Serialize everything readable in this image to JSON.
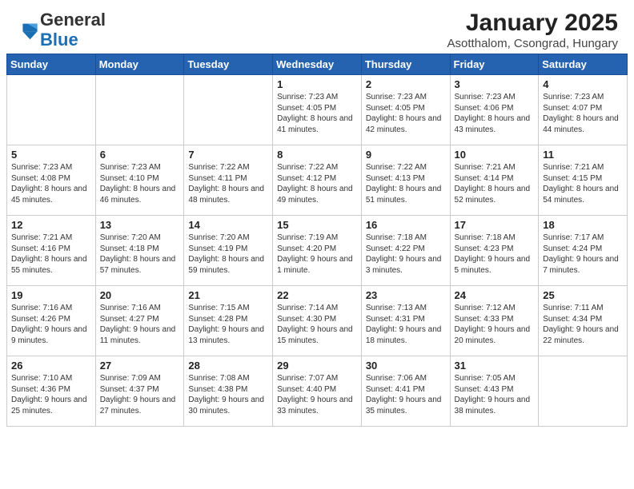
{
  "header": {
    "logo_general": "General",
    "logo_blue": "Blue",
    "month": "January 2025",
    "location": "Asotthalom, Csongrad, Hungary"
  },
  "days_of_week": [
    "Sunday",
    "Monday",
    "Tuesday",
    "Wednesday",
    "Thursday",
    "Friday",
    "Saturday"
  ],
  "weeks": [
    [
      {
        "day": "",
        "info": ""
      },
      {
        "day": "",
        "info": ""
      },
      {
        "day": "",
        "info": ""
      },
      {
        "day": "1",
        "info": "Sunrise: 7:23 AM\nSunset: 4:05 PM\nDaylight: 8 hours and 41 minutes."
      },
      {
        "day": "2",
        "info": "Sunrise: 7:23 AM\nSunset: 4:05 PM\nDaylight: 8 hours and 42 minutes."
      },
      {
        "day": "3",
        "info": "Sunrise: 7:23 AM\nSunset: 4:06 PM\nDaylight: 8 hours and 43 minutes."
      },
      {
        "day": "4",
        "info": "Sunrise: 7:23 AM\nSunset: 4:07 PM\nDaylight: 8 hours and 44 minutes."
      }
    ],
    [
      {
        "day": "5",
        "info": "Sunrise: 7:23 AM\nSunset: 4:08 PM\nDaylight: 8 hours and 45 minutes."
      },
      {
        "day": "6",
        "info": "Sunrise: 7:23 AM\nSunset: 4:10 PM\nDaylight: 8 hours and 46 minutes."
      },
      {
        "day": "7",
        "info": "Sunrise: 7:22 AM\nSunset: 4:11 PM\nDaylight: 8 hours and 48 minutes."
      },
      {
        "day": "8",
        "info": "Sunrise: 7:22 AM\nSunset: 4:12 PM\nDaylight: 8 hours and 49 minutes."
      },
      {
        "day": "9",
        "info": "Sunrise: 7:22 AM\nSunset: 4:13 PM\nDaylight: 8 hours and 51 minutes."
      },
      {
        "day": "10",
        "info": "Sunrise: 7:21 AM\nSunset: 4:14 PM\nDaylight: 8 hours and 52 minutes."
      },
      {
        "day": "11",
        "info": "Sunrise: 7:21 AM\nSunset: 4:15 PM\nDaylight: 8 hours and 54 minutes."
      }
    ],
    [
      {
        "day": "12",
        "info": "Sunrise: 7:21 AM\nSunset: 4:16 PM\nDaylight: 8 hours and 55 minutes."
      },
      {
        "day": "13",
        "info": "Sunrise: 7:20 AM\nSunset: 4:18 PM\nDaylight: 8 hours and 57 minutes."
      },
      {
        "day": "14",
        "info": "Sunrise: 7:20 AM\nSunset: 4:19 PM\nDaylight: 8 hours and 59 minutes."
      },
      {
        "day": "15",
        "info": "Sunrise: 7:19 AM\nSunset: 4:20 PM\nDaylight: 9 hours and 1 minute."
      },
      {
        "day": "16",
        "info": "Sunrise: 7:18 AM\nSunset: 4:22 PM\nDaylight: 9 hours and 3 minutes."
      },
      {
        "day": "17",
        "info": "Sunrise: 7:18 AM\nSunset: 4:23 PM\nDaylight: 9 hours and 5 minutes."
      },
      {
        "day": "18",
        "info": "Sunrise: 7:17 AM\nSunset: 4:24 PM\nDaylight: 9 hours and 7 minutes."
      }
    ],
    [
      {
        "day": "19",
        "info": "Sunrise: 7:16 AM\nSunset: 4:26 PM\nDaylight: 9 hours and 9 minutes."
      },
      {
        "day": "20",
        "info": "Sunrise: 7:16 AM\nSunset: 4:27 PM\nDaylight: 9 hours and 11 minutes."
      },
      {
        "day": "21",
        "info": "Sunrise: 7:15 AM\nSunset: 4:28 PM\nDaylight: 9 hours and 13 minutes."
      },
      {
        "day": "22",
        "info": "Sunrise: 7:14 AM\nSunset: 4:30 PM\nDaylight: 9 hours and 15 minutes."
      },
      {
        "day": "23",
        "info": "Sunrise: 7:13 AM\nSunset: 4:31 PM\nDaylight: 9 hours and 18 minutes."
      },
      {
        "day": "24",
        "info": "Sunrise: 7:12 AM\nSunset: 4:33 PM\nDaylight: 9 hours and 20 minutes."
      },
      {
        "day": "25",
        "info": "Sunrise: 7:11 AM\nSunset: 4:34 PM\nDaylight: 9 hours and 22 minutes."
      }
    ],
    [
      {
        "day": "26",
        "info": "Sunrise: 7:10 AM\nSunset: 4:36 PM\nDaylight: 9 hours and 25 minutes."
      },
      {
        "day": "27",
        "info": "Sunrise: 7:09 AM\nSunset: 4:37 PM\nDaylight: 9 hours and 27 minutes."
      },
      {
        "day": "28",
        "info": "Sunrise: 7:08 AM\nSunset: 4:38 PM\nDaylight: 9 hours and 30 minutes."
      },
      {
        "day": "29",
        "info": "Sunrise: 7:07 AM\nSunset: 4:40 PM\nDaylight: 9 hours and 33 minutes."
      },
      {
        "day": "30",
        "info": "Sunrise: 7:06 AM\nSunset: 4:41 PM\nDaylight: 9 hours and 35 minutes."
      },
      {
        "day": "31",
        "info": "Sunrise: 7:05 AM\nSunset: 4:43 PM\nDaylight: 9 hours and 38 minutes."
      },
      {
        "day": "",
        "info": ""
      }
    ]
  ]
}
